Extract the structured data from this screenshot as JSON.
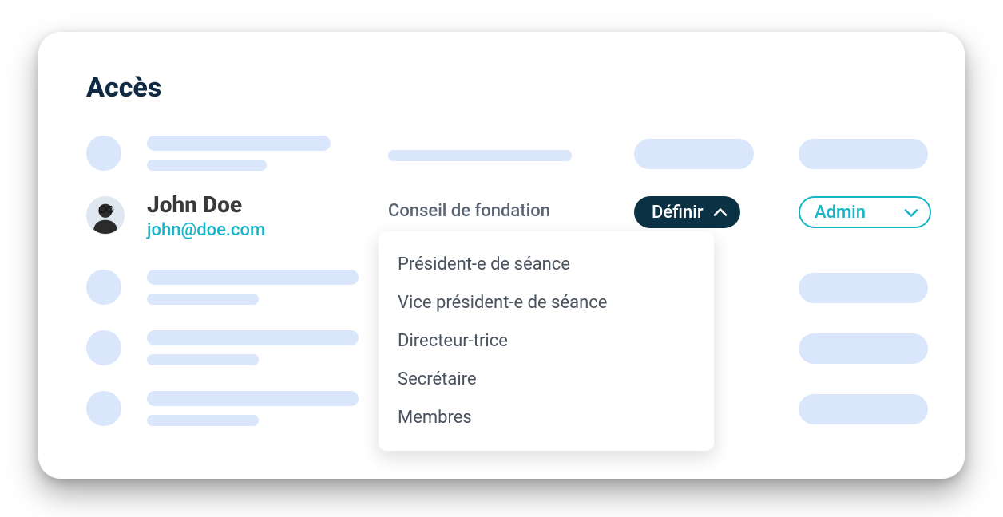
{
  "title": "Accès",
  "user": {
    "name": "John Doe",
    "email": "john@doe.com",
    "council": "Conseil de fondation"
  },
  "define_label": "Définir",
  "admin_label": "Admin",
  "roles": [
    "Président-e de séance",
    "Vice président-e de séance",
    "Directeur-trice",
    "Secrétaire",
    "Membres"
  ]
}
